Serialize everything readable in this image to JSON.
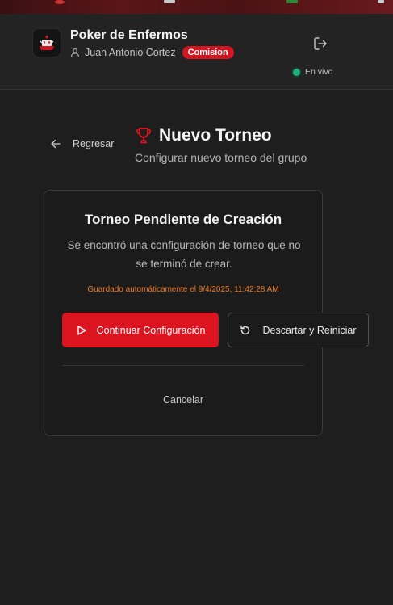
{
  "header": {
    "app_title": "Poker de Enfermos",
    "user_name": "Juan Antonio Cortez",
    "role_badge": "Comision",
    "live_status": "En vivo",
    "logout_icon": "logout-icon",
    "user_icon": "user-icon",
    "logo_icon": "poker-logo"
  },
  "page": {
    "back_label": "Regresar",
    "title": "Nuevo Torneo",
    "subtitle": "Configurar nuevo torneo del grupo",
    "title_icon": "trophy-icon"
  },
  "card": {
    "title": "Torneo Pendiente de Creación",
    "description": "Se encontró una configuración de torneo que no se terminó de crear.",
    "saved_note": "Guardado automáticamente el 9/4/2025, 11:42:28 AM",
    "continue_label": "Continuar Configuración",
    "discard_label": "Descartar y Reiniciar",
    "cancel_label": "Cancelar"
  },
  "colors": {
    "accent": "#db1420",
    "warning_text": "#ef7a1f",
    "live": "#22b07a",
    "background": "#1e1e1f"
  }
}
